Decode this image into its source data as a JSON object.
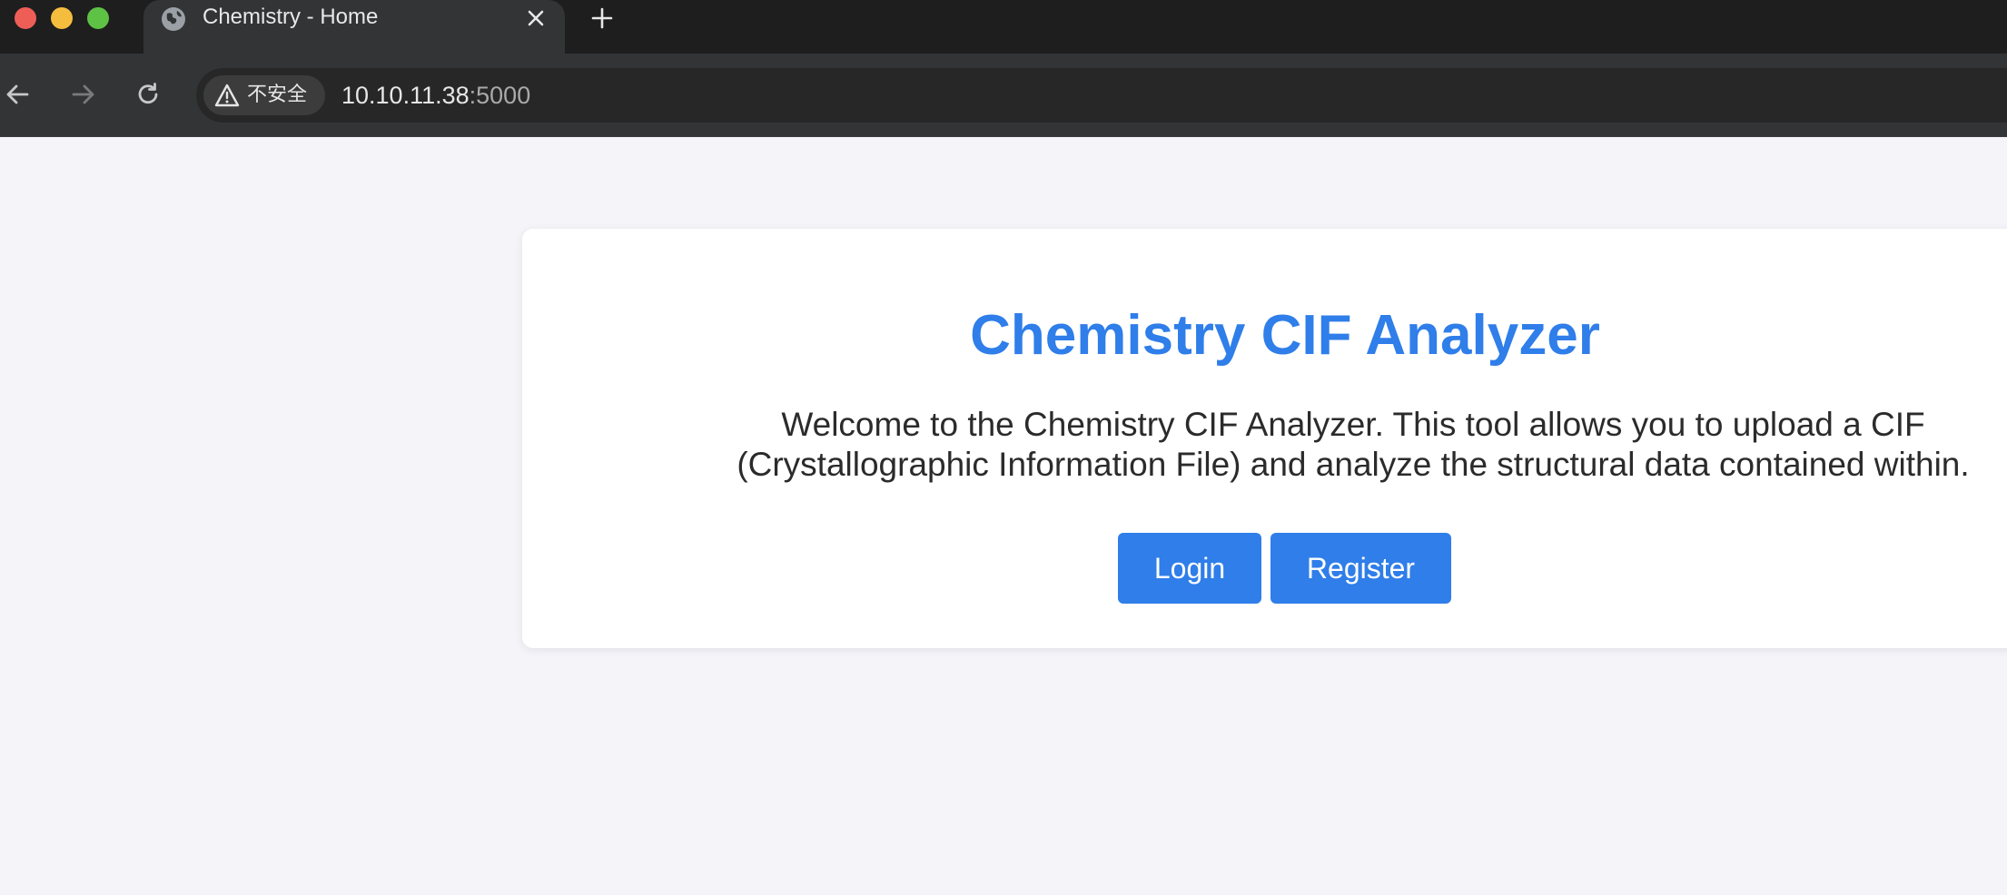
{
  "browser": {
    "tab": {
      "title": "Chemistry - Home"
    },
    "omnibox": {
      "security_label": "不安全",
      "url_host": "10.10.11.38",
      "url_port": ":5000"
    }
  },
  "page": {
    "heading": "Chemistry CIF Analyzer",
    "welcome": "Welcome to the Chemistry CIF Analyzer. This tool allows you to upload a CIF (Crystallographic Information File) and analyze the structural data contained within.",
    "login_label": "Login",
    "register_label": "Register"
  },
  "colors": {
    "accent": "#2f7ee9",
    "page_background": "#f4f4f9",
    "card_background": "#ffffff"
  }
}
